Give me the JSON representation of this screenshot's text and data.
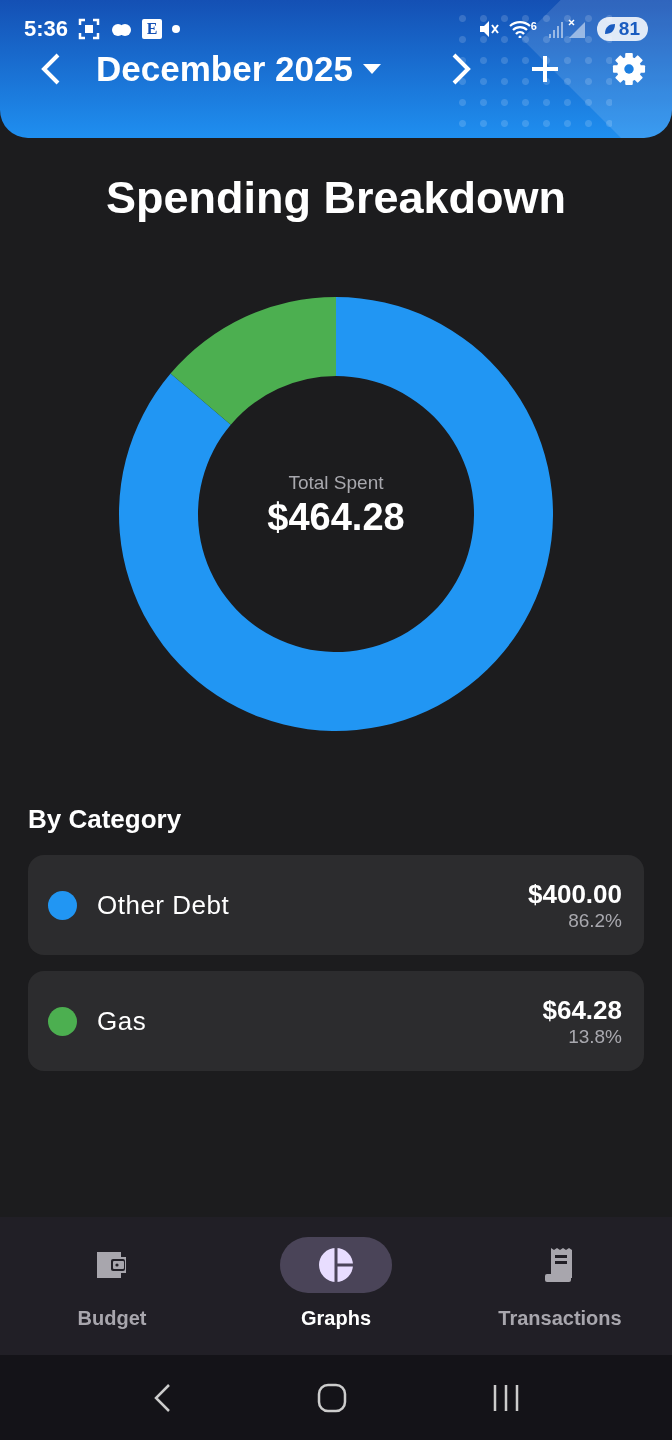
{
  "status_bar": {
    "time": "5:36",
    "notification_letter": "E",
    "wifi_label": "6",
    "battery": "81"
  },
  "header": {
    "month": "December 2025"
  },
  "title": "Spending Breakdown",
  "chart": {
    "center_label": "Total Spent",
    "center_value": "$464.28",
    "chart_data": {
      "type": "donut",
      "values": [
        86.2,
        13.8
      ]
    }
  },
  "categories_heading": "By Category",
  "categories": [
    {
      "name": "Other Debt",
      "color": "#2196f3",
      "amount": "$400.00",
      "percent": "86.2%"
    },
    {
      "name": "Gas",
      "color": "#4caf50",
      "amount": "$64.28",
      "percent": "13.8%"
    }
  ],
  "bottom_nav": [
    {
      "label": "Budget",
      "kind": "wallet",
      "selected": false
    },
    {
      "label": "Graphs",
      "kind": "chart",
      "selected": true
    },
    {
      "label": "Transactions",
      "kind": "receipt",
      "selected": false
    }
  ]
}
